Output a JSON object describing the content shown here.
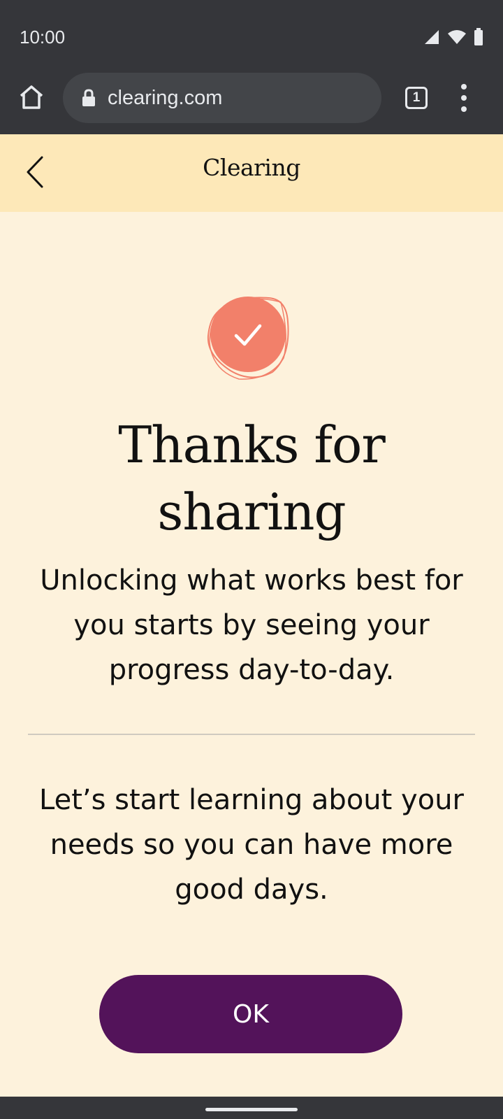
{
  "status_bar": {
    "time": "10:00",
    "icons": [
      "cell-signal-icon",
      "wifi-icon",
      "battery-icon"
    ]
  },
  "browser": {
    "url": "clearing.com",
    "tab_count": "1",
    "icons": [
      "home-icon",
      "lock-icon",
      "tabs-icon",
      "more-vert-icon"
    ]
  },
  "app_header": {
    "title": "Clearing",
    "back_icon": "chevron-left-icon"
  },
  "content": {
    "badge_icon": "check-icon",
    "headline": "Thanks for sharing",
    "subtext": "Unlocking what works best for you starts by seeing your progress day-to-day.",
    "subtext2": "Let’s start learning about your needs so you can have more good days.",
    "ok_label": "OK"
  },
  "colors": {
    "chrome": "#35363a",
    "header_bg": "#fde8b8",
    "page_bg": "#fdf2dc",
    "badge": "#f2806a",
    "button": "#53135a"
  }
}
